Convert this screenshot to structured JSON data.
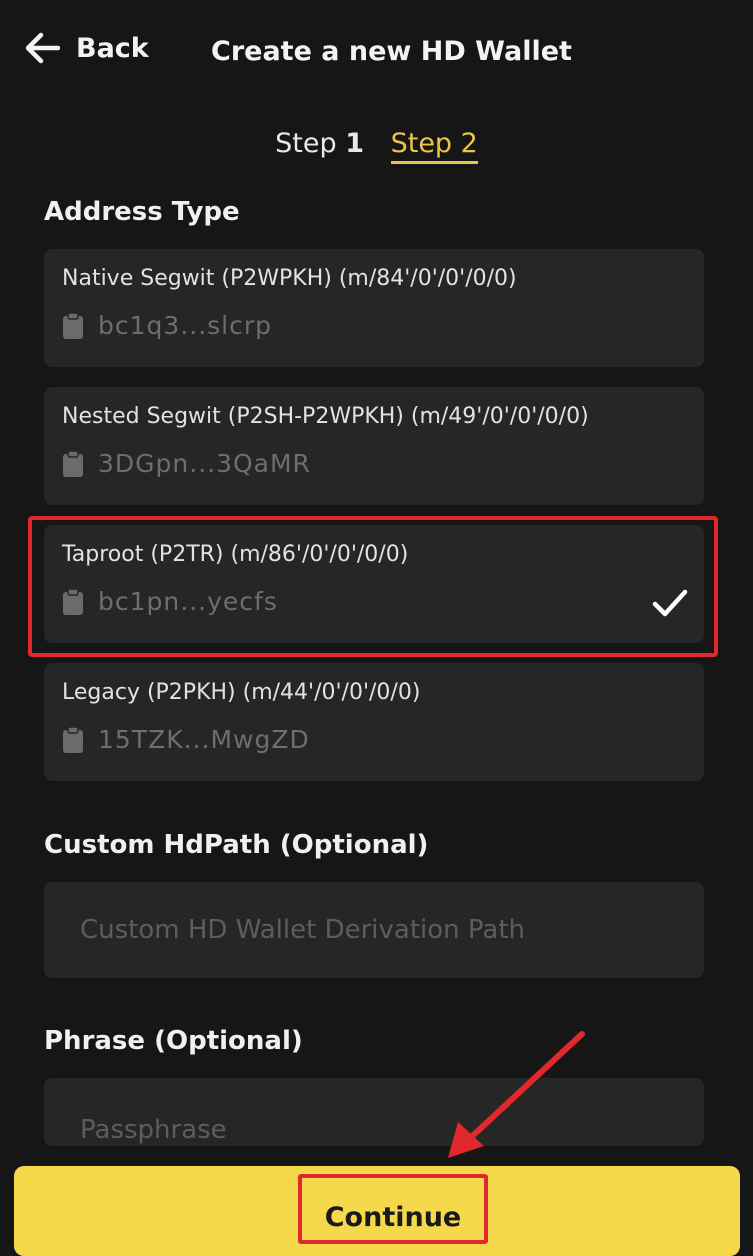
{
  "header": {
    "back_label": "Back",
    "title": "Create a new HD Wallet"
  },
  "steps": [
    {
      "label": "Step ",
      "num": "1",
      "active": false
    },
    {
      "label": "Step 2",
      "active": true
    }
  ],
  "address_type": {
    "label": "Address Type",
    "options": [
      {
        "name": "Native Segwit (P2WPKH) (m/84'/0'/0'/0/0)",
        "address": "bc1q3...slcrp",
        "selected": false
      },
      {
        "name": "Nested Segwit (P2SH-P2WPKH) (m/49'/0'/0'/0/0)",
        "address": "3DGpn...3QaMR",
        "selected": false
      },
      {
        "name": "Taproot (P2TR) (m/86'/0'/0'/0/0)",
        "address": "bc1pn...yecfs",
        "selected": true
      },
      {
        "name": "Legacy (P2PKH) (m/44'/0'/0'/0/0)",
        "address": "15TZK...MwgZD",
        "selected": false
      }
    ]
  },
  "custom_hdpath": {
    "label": "Custom HdPath (Optional)",
    "placeholder": "Custom HD Wallet Derivation Path",
    "value": ""
  },
  "phrase": {
    "label": "Phrase (Optional)",
    "placeholder": "Passphrase",
    "value": ""
  },
  "continue_label": "Continue",
  "colors": {
    "background": "#161616",
    "card": "#262626",
    "accent": "#ebc44a",
    "button": "#f5d94a",
    "annotation": "#e0282d"
  },
  "icons": {
    "back": "arrow-left-icon",
    "copy": "clipboard-icon",
    "selected": "check-icon"
  }
}
